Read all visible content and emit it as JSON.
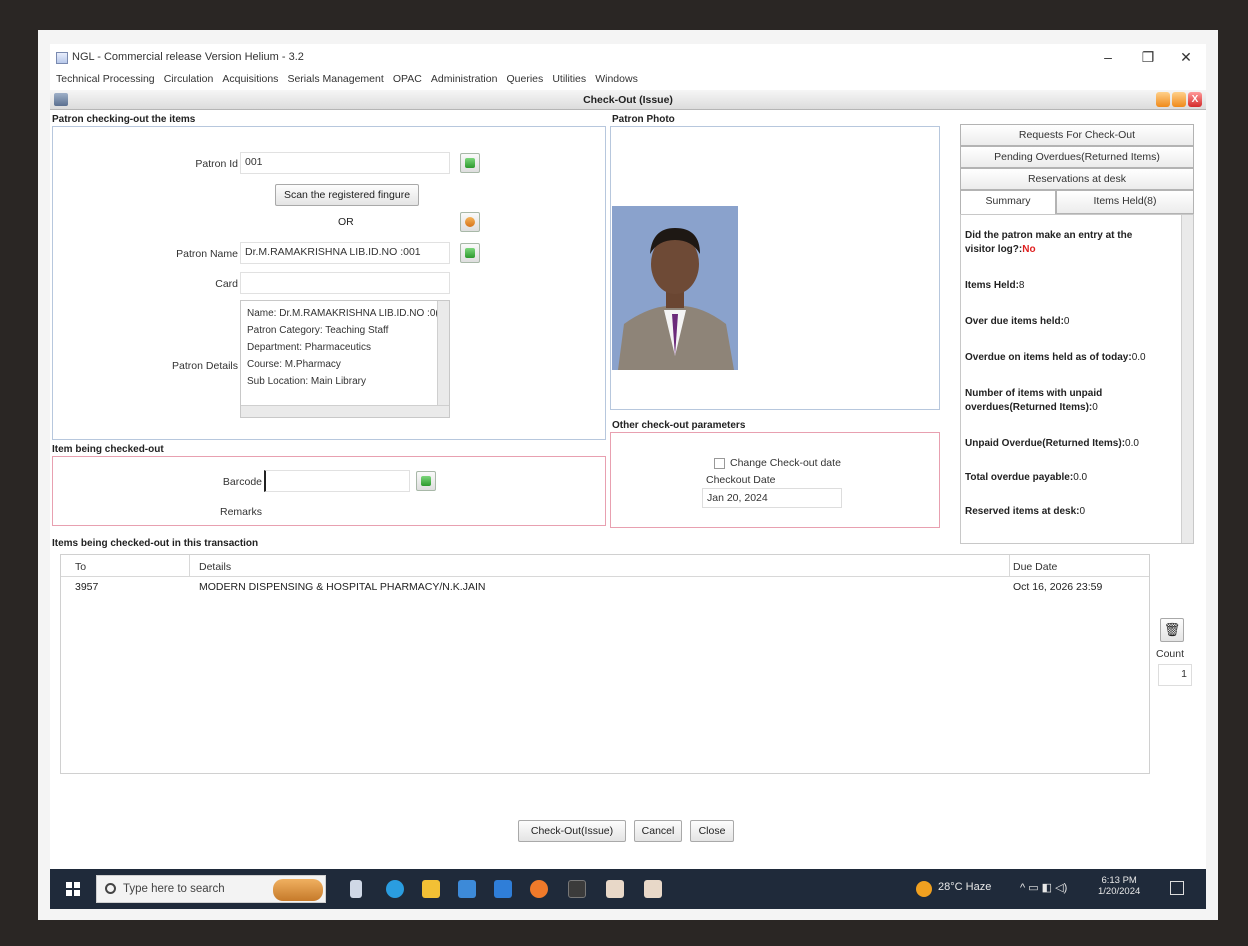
{
  "app": {
    "title": "NGL - Commercial release Version Helium - 3.2",
    "menu": [
      "Technical Processing",
      "Circulation",
      "Acquisitions",
      "Serials Management",
      "OPAC",
      "Administration",
      "Queries",
      "Utilities",
      "Windows"
    ]
  },
  "window": {
    "title": "Check-Out (Issue)",
    "min_glyph": "–",
    "max_glyph": "▢",
    "close_glyph": "X"
  },
  "patron_section": {
    "title": "Patron checking-out the items",
    "patron_id_label": "Patron Id",
    "patron_id_value": "001",
    "scan_button": "Scan the registered fingure",
    "or_label": "OR",
    "patron_name_label": "Patron Name",
    "patron_name_value": "Dr.M.RAMAKRISHNA LIB.ID.NO :001",
    "card_label": "Card",
    "card_value": "",
    "patron_details_label": "Patron Details",
    "details_lines": [
      "Name: Dr.M.RAMAKRISHNA LIB.ID.NO :0(",
      "Patron Category: Teaching Staff",
      "Department: Pharmaceutics",
      "Course: M.Pharmacy",
      "Sub Location: Main Library"
    ]
  },
  "photo_section": {
    "title": "Patron Photo"
  },
  "item_section": {
    "title": "Item being checked-out",
    "barcode_label": "Barcode",
    "barcode_value": "",
    "remarks_label": "Remarks",
    "remarks_value": ""
  },
  "other_params": {
    "title": "Other check-out parameters",
    "change_date_label": "Change Check-out date",
    "checkout_date_label": "Checkout Date",
    "checkout_date_value": "Jan 20, 2024"
  },
  "tabs": {
    "requests": "Requests For Check-Out",
    "pending": "Pending Overdues(Returned Items)",
    "reservations": "Reservations at desk",
    "summary": "Summary",
    "items_held": "Items Held(8)"
  },
  "summary": {
    "visitor_log_q": "Did the patron make an entry at the visitor log?:",
    "visitor_log_a": "No",
    "items_held_label": "Items Held:",
    "items_held_value": "8",
    "overdue_held_label": "Over due items held:",
    "overdue_held_value": "0",
    "overdue_today_label": "Overdue on items held as of today:",
    "overdue_today_value": "0.0",
    "unpaid_count_label": "Number of items with unpaid overdues(Returned Items):",
    "unpaid_count_value": "0",
    "unpaid_overdue_label": "Unpaid Overdue(Returned Items):",
    "unpaid_overdue_value": "0.0",
    "total_payable_label": "Total overdue payable:",
    "total_payable_value": "0.0",
    "reserved_label": "Reserved items at desk:",
    "reserved_value": "0"
  },
  "transaction": {
    "title": "Items being checked-out in this transaction",
    "columns": [
      "To",
      "Details",
      "Due Date"
    ],
    "rows": [
      {
        "to": "3957",
        "details": "MODERN DISPENSING & HOSPITAL PHARMACY/N.K.JAIN",
        "due": "Oct 16, 2026 23:59"
      }
    ],
    "count_label": "Count",
    "count_value": "1"
  },
  "buttons": {
    "checkout": "Check-Out(Issue)",
    "cancel": "Cancel",
    "close": "Close"
  },
  "taskbar": {
    "search_placeholder": "Type here to search",
    "weather": "28°C Haze",
    "time": "6:13 PM",
    "date": "1/20/2024"
  }
}
